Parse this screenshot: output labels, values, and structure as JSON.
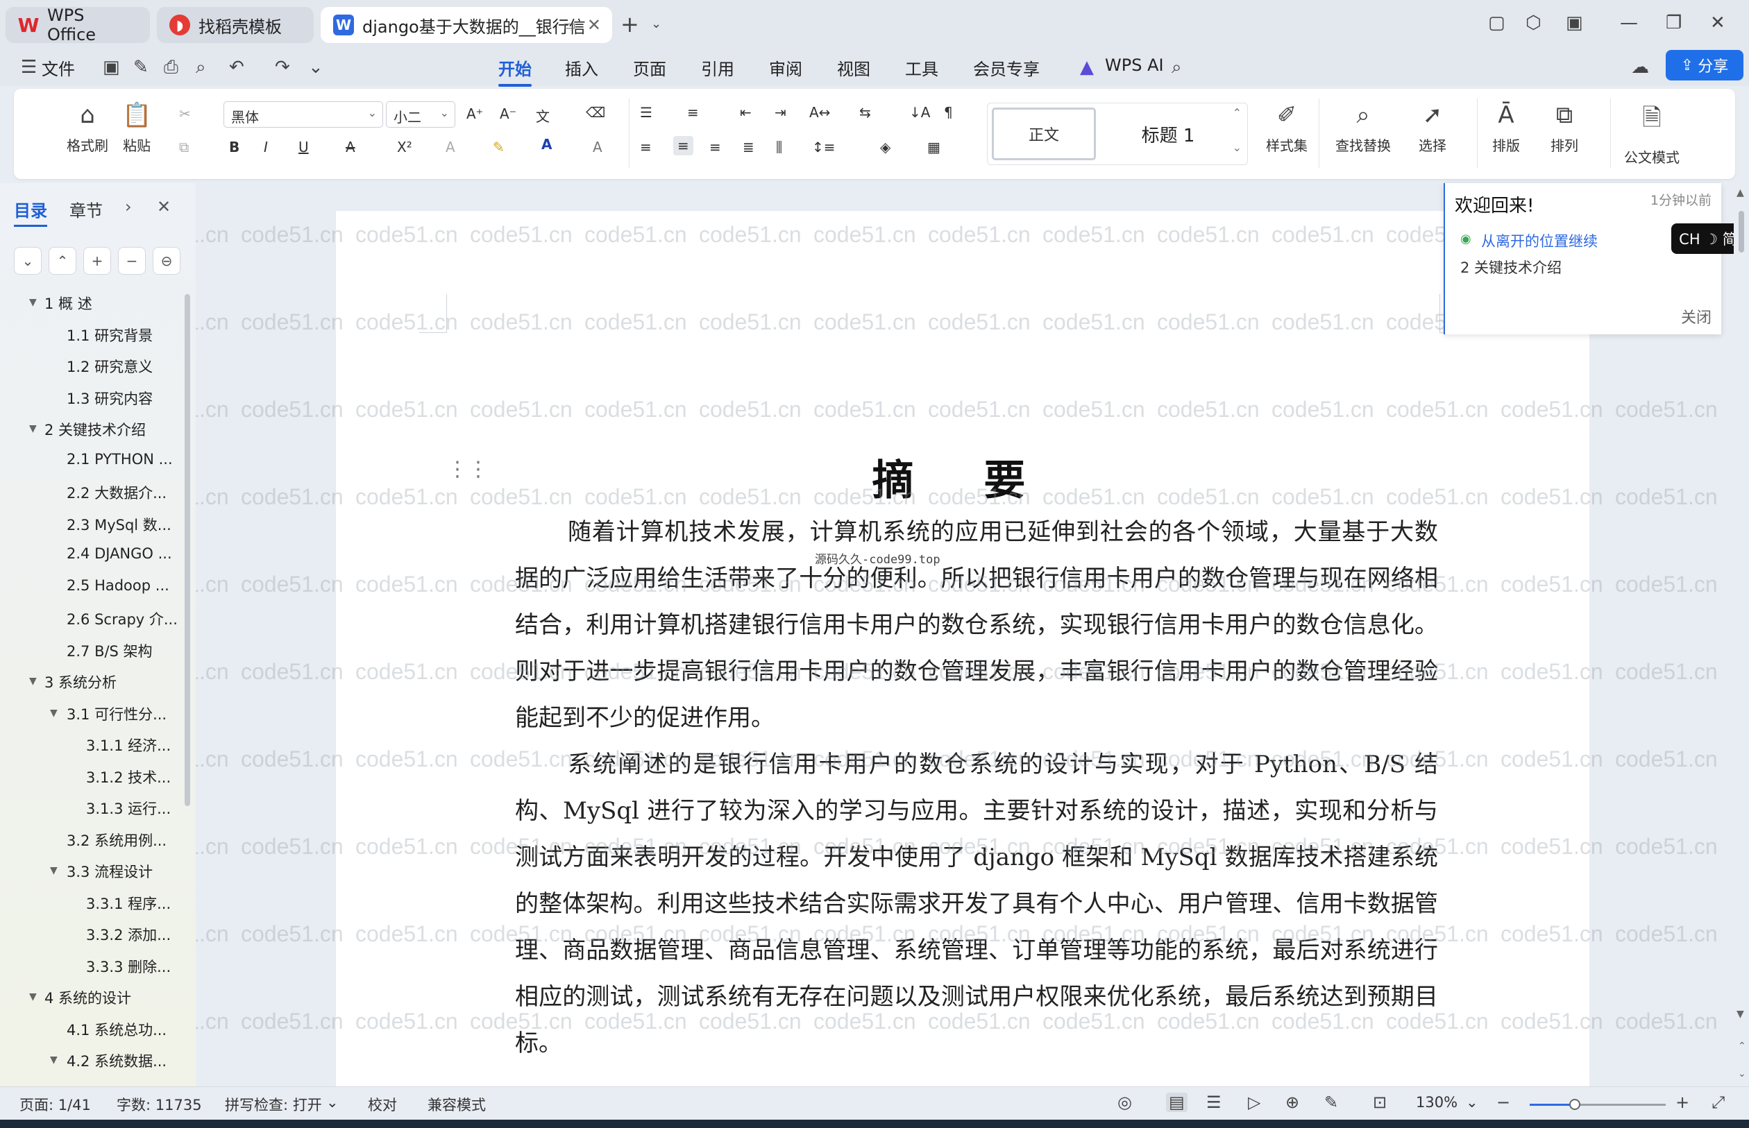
{
  "window": {
    "tabs": [
      {
        "label": "WPS Office"
      },
      {
        "label": "找稻壳模板"
      },
      {
        "label": "django基于大数据的__银行信"
      }
    ]
  },
  "menu": {
    "file": "文件",
    "items": [
      "开始",
      "插入",
      "页面",
      "引用",
      "审阅",
      "视图",
      "工具",
      "会员专享"
    ],
    "active": "开始",
    "wps_ai": "WPS AI",
    "share": "分享"
  },
  "ribbon": {
    "format_painter": "格式刷",
    "paste": "粘贴",
    "font_name": "黑体",
    "font_size": "小二",
    "style_normal": "正文",
    "style_heading1": "标题 1",
    "style_set": "样式集",
    "find_replace": "查找替换",
    "select": "选择",
    "layout": "排版",
    "arrange": "排列",
    "official_mode": "公文模式"
  },
  "sidebar": {
    "tab_toc": "目录",
    "tab_chapter": "章节",
    "toc": [
      {
        "label": "1   概    述",
        "level": 1,
        "expanded": true
      },
      {
        "label": "1.1 研究背景",
        "level": 2
      },
      {
        "label": "1.2 研究意义",
        "level": 2
      },
      {
        "label": "1.3 研究内容",
        "level": 2
      },
      {
        "label": "2   关键技术介绍",
        "level": 1,
        "expanded": true
      },
      {
        "label": "2.1 PYTHON ...",
        "level": 2
      },
      {
        "label": "2.2 大数据介...",
        "level": 2
      },
      {
        "label": "2.3 MySql 数...",
        "level": 2
      },
      {
        "label": "2.4 DJANGO ...",
        "level": 2
      },
      {
        "label": "2.5 Hadoop ...",
        "level": 2
      },
      {
        "label": "2.6 Scrapy 介...",
        "level": 2
      },
      {
        "label": "2.7 B/S 架构",
        "level": 2
      },
      {
        "label": "3   系统分析",
        "level": 1,
        "expanded": true
      },
      {
        "label": "3.1 可行性分...",
        "level": 2,
        "expanded": true
      },
      {
        "label": "3.1.1 经济...",
        "level": 3
      },
      {
        "label": "3.1.2 技术...",
        "level": 3
      },
      {
        "label": "3.1.3 运行...",
        "level": 3
      },
      {
        "label": "3.2 系统用例...",
        "level": 2
      },
      {
        "label": "3.3 流程设计",
        "level": 2,
        "expanded": true
      },
      {
        "label": "3.3.1 程序...",
        "level": 3
      },
      {
        "label": "3.3.2 添加...",
        "level": 3
      },
      {
        "label": "3.3.3 删除...",
        "level": 3
      },
      {
        "label": "4   系统的设计",
        "level": 1,
        "expanded": true
      },
      {
        "label": "4.1 系统总功...",
        "level": 2
      },
      {
        "label": "4.2 系统数据...",
        "level": 2,
        "expanded": true
      }
    ]
  },
  "document": {
    "title": "摘    要",
    "overlay_text": "源码久久-code99.top",
    "paragraphs": [
      "随着计算机技术发展，计算机系统的应用已延伸到社会的各个领域，大量基于大数据的广泛应用给生活带来了十分的便利。所以把银行信用卡用户的数仓管理与现在网络相结合，利用计算机搭建银行信用卡用户的数仓系统，实现银行信用卡用户的数仓信息化。则对于进一步提高银行信用卡用户的数仓管理发展，丰富银行信用卡用户的数仓管理经验能起到不少的促进作用。",
      "系统阐述的是银行信用卡用户的数仓系统的设计与实现，对于 Python、B/S 结构、MySql 进行了较为深入的学习与应用。主要针对系统的设计，描述，实现和分析与测试方面来表明开发的过程。开发中使用了 django 框架和 MySql 数据库技术搭建系统的整体架构。利用这些技术结合实际需求开发了具有个人中心、用户管理、信用卡数据管理、商品数据管理、商品信息管理、系统管理、订单管理等功能的系统，最后对系统进行相应的测试，测试系统有无存在问题以及测试用户权限来优化系统，最后系统达到预期目标。"
    ],
    "watermark": "code51.cn"
  },
  "welcome_popup": {
    "title": "欢迎回来!",
    "time": "1分钟以前",
    "continue_link": "从离开的位置继续",
    "section": "2  关键技术介绍",
    "close": "关闭"
  },
  "ime": {
    "label": "CH ☽ 简"
  },
  "statusbar": {
    "page": "页面: 1/41",
    "word_count": "字数: 11735",
    "spell_check": "拼写检查: 打开",
    "proofread": "校对",
    "compat_mode": "兼容模式",
    "zoom": "130%",
    "zoom_fraction": 0.33
  }
}
